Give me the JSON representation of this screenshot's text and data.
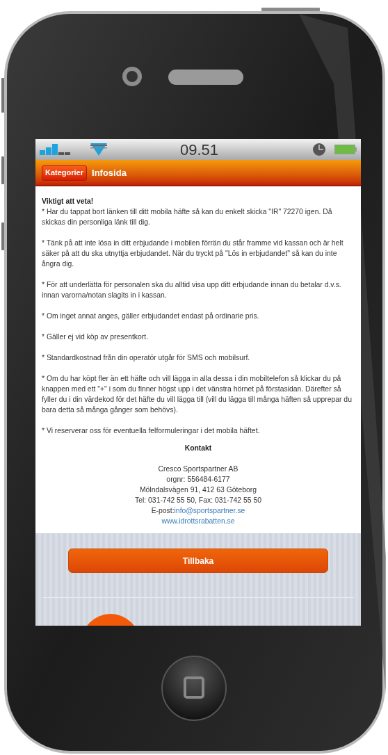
{
  "status_bar": {
    "time": "09.51"
  },
  "header": {
    "category_button": "Kategorier",
    "title": "Infosida"
  },
  "content": {
    "heading": "Viktigt att veta!",
    "paragraphs": [
      "* Har du tappat bort länken till ditt mobila häfte så kan du enkelt skicka \"IR\" 72270 igen. Då skickas din personliga länk till dig.",
      "* Tänk på att inte lösa in ditt erbjudande i mobilen förrän du står framme vid kassan och är helt säker på att du ska utnyttja erbjudandet. När du tryckt på \"Lös in erbjudandet\" så kan du inte ångra dig.",
      "* För att underlätta för personalen ska du alltid visa upp ditt erbjudande innan du betalar d.v.s. innan varorna/notan slagits in i kassan.",
      "* Om inget annat anges, gäller erbjudandet endast på ordinarie pris.",
      "* Gäller ej vid köp av presentkort.",
      "* Standardkostnad från din operatör utgår för SMS och mobilsurf.",
      "* Om du har köpt fler än ett häfte och vill lägga in alla dessa i din mobiltelefon så klickar du på knappen med ett \"+\" i som du finner högst upp i det vänstra hörnet på förstasidan. Därefter så fyller du i din värdekod för det häfte du vill lägga till (vill du lägga till många häften så upprepar du bara detta så många gånger som behövs).",
      "* Vi reserverar oss för eventuella felformuleringar i det mobila häftet."
    ],
    "contact": {
      "heading": "Kontakt",
      "lines": [
        "Cresco Sportspartner AB",
        "orgnr: 556484-6177",
        "Mölndalsvägen 91, 412 63 Göteborg",
        "Tel: 031-742 55 50, Fax: 031-742 55 50"
      ],
      "email_label": "E-post:",
      "email": "info@sportspartner.se",
      "website": "www.idrottsrabatten.se"
    }
  },
  "back_button": "Tillbaka"
}
